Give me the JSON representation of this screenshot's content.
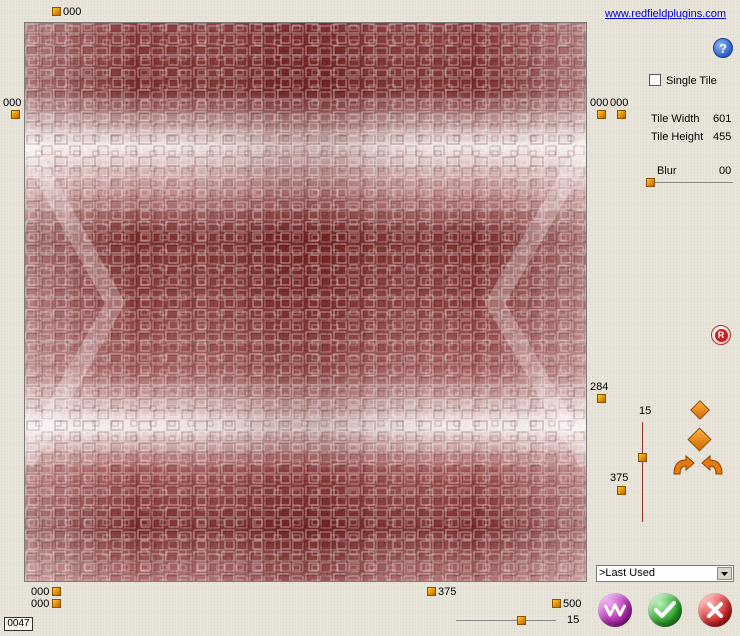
{
  "header": {
    "link_text": "www.redfieldplugins.com"
  },
  "preview": {
    "top_offset_label": "000",
    "left_offset_label": "000",
    "right_labels": [
      "000",
      "000"
    ],
    "bottom_left_labels": [
      "000",
      "000"
    ],
    "bottom_mid_label": "375",
    "bottom_right_label": "500",
    "right_mid_label": "284",
    "counter": "0047"
  },
  "options": {
    "single_tile_label": "Single Tile",
    "single_tile_checked": false,
    "tile_width_label": "Tile Width",
    "tile_width_value": "601",
    "tile_height_label": "Tile Height",
    "tile_height_value": "455",
    "blur_label": "Blur",
    "blur_value": "00"
  },
  "vertical_slider": {
    "top_label": "15",
    "left_label": "375"
  },
  "bottom_slider": {
    "value": "15"
  },
  "preset": {
    "selected": ">Last Used"
  },
  "colors": {
    "accent_link": "#0000cc",
    "randomize_btn": "#cc2020",
    "help_btn": "#2a5fc4",
    "ok_btn": "#2ea52e",
    "cancel_btn": "#d42a2a",
    "plugin_btn": "#b02ab0"
  }
}
